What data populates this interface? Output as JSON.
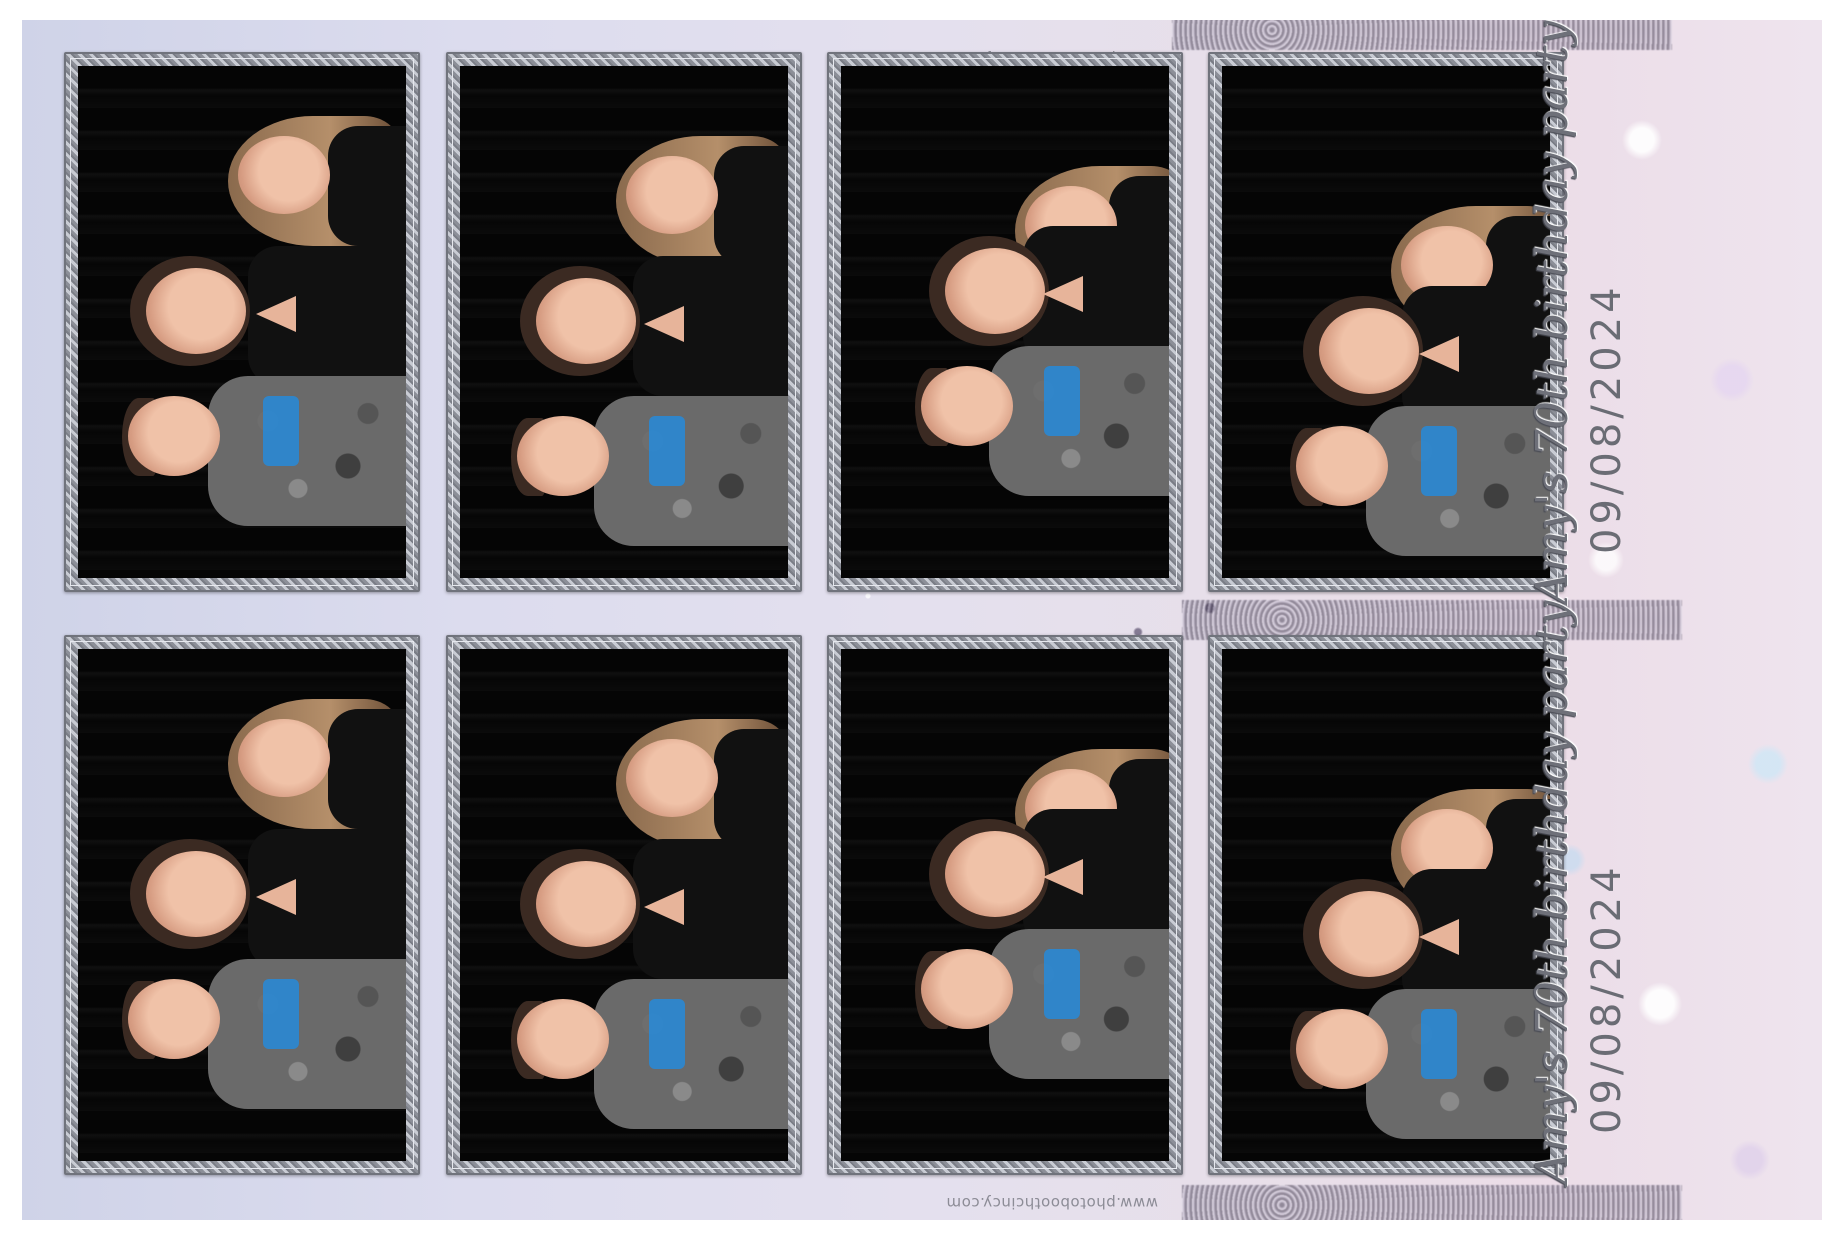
{
  "watermark": {
    "text": "www.photoboothcincy.com"
  },
  "caption": {
    "title": "Amy's 70th birthday party",
    "date": "09/08/2024"
  },
  "photos": [
    {
      "row": 1,
      "col": 1,
      "alt": "Boy in camo shirt, woman and girl smiling"
    },
    {
      "row": 1,
      "col": 2,
      "alt": "Boy in camo shirt, woman and girl smiling"
    },
    {
      "row": 1,
      "col": 3,
      "alt": "Boy in camo shirt, woman and girl smiling"
    },
    {
      "row": 1,
      "col": 4,
      "alt": "Boy in camo shirt, woman and girl smiling"
    },
    {
      "row": 2,
      "col": 1,
      "alt": "Boy in camo shirt, woman and girl smiling"
    },
    {
      "row": 2,
      "col": 2,
      "alt": "Boy in camo shirt, woman and girl smiling"
    },
    {
      "row": 2,
      "col": 3,
      "alt": "Boy in camo shirt, woman and girl smiling"
    },
    {
      "row": 2,
      "col": 4,
      "alt": "Boy in camo shirt, woman and girl smiling"
    }
  ],
  "colors": {
    "frame": "#8c8f98",
    "background": "#dcdcee",
    "caption_text": "#6e7079",
    "logo_blue": "#2a88d4"
  }
}
